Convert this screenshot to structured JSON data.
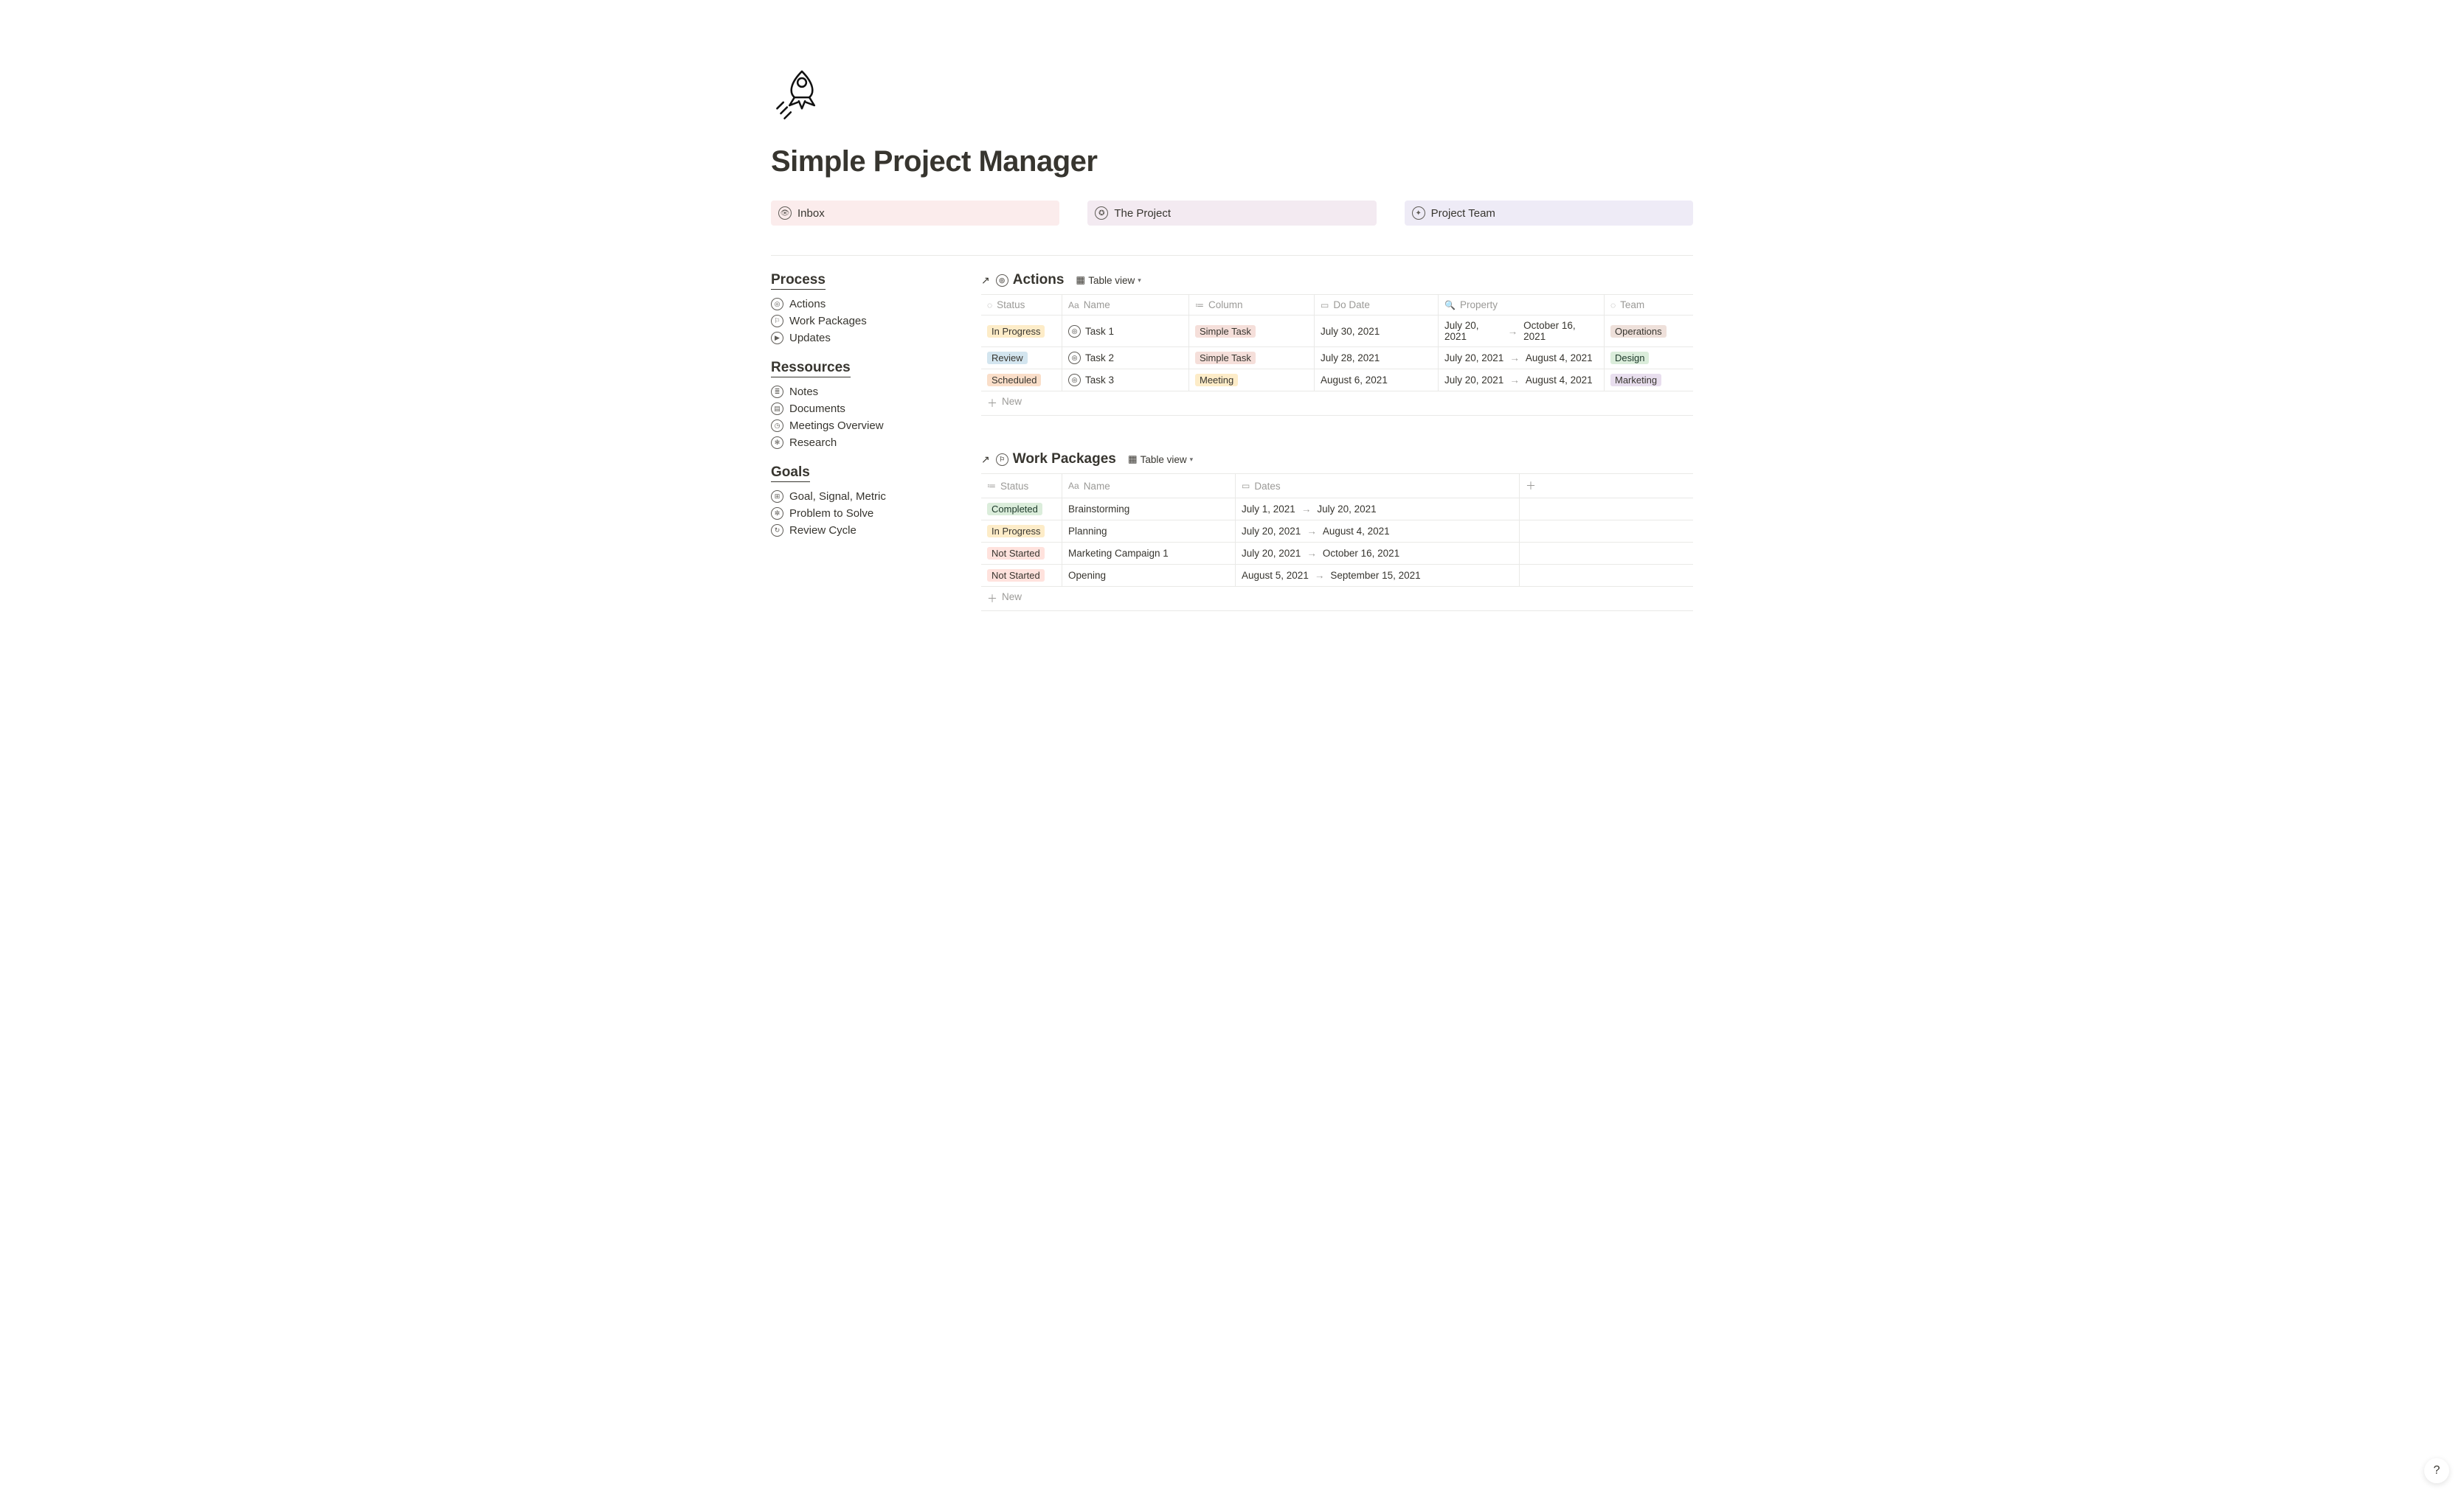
{
  "page": {
    "title": "Simple Project Manager"
  },
  "quick_links": {
    "inbox": {
      "label": "Inbox"
    },
    "project": {
      "label": "The Project"
    },
    "team": {
      "label": "Project Team"
    }
  },
  "sidebar": {
    "process": {
      "heading": "Process",
      "actions": "Actions",
      "work_packages": "Work Packages",
      "updates": "Updates"
    },
    "resources": {
      "heading": "Ressources",
      "notes": "Notes",
      "documents": "Documents",
      "meetings": "Meetings Overview",
      "research": "Research"
    },
    "goals": {
      "heading": "Goals",
      "gsm": "Goal, Signal, Metric",
      "problem": "Problem to Solve",
      "review": "Review Cycle"
    }
  },
  "actions_db": {
    "title": "Actions",
    "view_label": "Table view",
    "columns": {
      "status": "Status",
      "name": "Name",
      "column": "Column",
      "do_date": "Do Date",
      "property": "Property",
      "team": "Team"
    },
    "rows": [
      {
        "status": "In Progress",
        "status_cls": "pill-yellow",
        "name": "Task 1",
        "column": "Simple Task",
        "column_cls": "pill-pink",
        "do_date": "July 30, 2021",
        "property_from": "July 20, 2021",
        "property_to": "October 16, 2021",
        "team": "Operations",
        "team_cls": "pill-brown"
      },
      {
        "status": "Review",
        "status_cls": "pill-blue",
        "name": "Task 2",
        "column": "Simple Task",
        "column_cls": "pill-pink",
        "do_date": "July 28, 2021",
        "property_from": "July 20, 2021",
        "property_to": "August 4, 2021",
        "team": "Design",
        "team_cls": "pill-green"
      },
      {
        "status": "Scheduled",
        "status_cls": "pill-orange",
        "name": "Task 3",
        "column": "Meeting",
        "column_cls": "pill-yellowsoft",
        "do_date": "August 6, 2021",
        "property_from": "July 20, 2021",
        "property_to": "August 4, 2021",
        "team": "Marketing",
        "team_cls": "pill-purple"
      }
    ],
    "new_label": "New"
  },
  "wp_db": {
    "title": "Work Packages",
    "view_label": "Table view",
    "columns": {
      "status": "Status",
      "name": "Name",
      "dates": "Dates"
    },
    "rows": [
      {
        "status": "Completed",
        "status_cls": "pill-green",
        "name": "Brainstorming",
        "date_from": "July 1, 2021",
        "date_to": "July 20, 2021"
      },
      {
        "status": "In Progress",
        "status_cls": "pill-yellow",
        "name": "Planning",
        "date_from": "July 20, 2021",
        "date_to": "August 4, 2021"
      },
      {
        "status": "Not Started",
        "status_cls": "pill-red",
        "name": "Marketing Campaign 1",
        "date_from": "July 20, 2021",
        "date_to": "October 16, 2021"
      },
      {
        "status": "Not Started",
        "status_cls": "pill-red",
        "name": "Opening",
        "date_from": "August 5, 2021",
        "date_to": "September 15, 2021"
      }
    ],
    "new_label": "New"
  },
  "help": {
    "label": "?"
  }
}
